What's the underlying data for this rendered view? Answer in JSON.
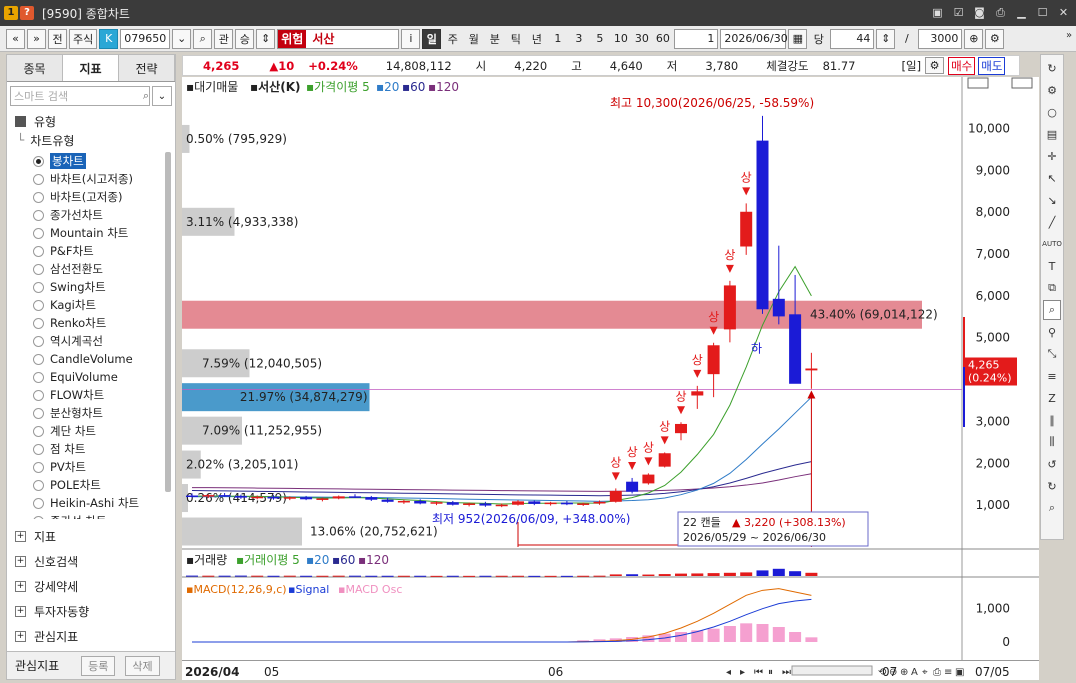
{
  "window": {
    "code": "[9590]",
    "title": "종합차트",
    "badge1": "1",
    "badge2": "?"
  },
  "toolbar": {
    "prev": "«",
    "down": "»",
    "jeon": "전",
    "market": "주식",
    "k_badge": "K",
    "stock_code": "079650",
    "gwan": "관",
    "seung": "승",
    "risk": "위험",
    "stock_name": "서산",
    "info": "i",
    "periods": [
      "일",
      "주",
      "월",
      "분",
      "틱",
      "년"
    ],
    "active_period": "일",
    "intervals": [
      "1",
      "3",
      "5",
      "10",
      "30",
      "60"
    ],
    "interval_value": "1",
    "date": "2026/06/30",
    "dang": "당",
    "count": "44",
    "slash": "/",
    "total": "3000"
  },
  "left": {
    "tabs": [
      "종목",
      "지표",
      "전략"
    ],
    "active_tab": "지표",
    "search_placeholder": "스마트 검색",
    "group_type": "유형",
    "subgroup": "차트유형",
    "chart_types": [
      "봉차트",
      "바차트(시고저종)",
      "바차트(고저종)",
      "종가선차트",
      "Mountain 차트",
      "P&F차트",
      "삼선전환도",
      "Swing차트",
      "Kagi차트",
      "Renko차트",
      "역시계곡선",
      "CandleVolume",
      "EquiVolume",
      "FLOW차트",
      "분산형차트",
      "계단 차트",
      "점 차트",
      "PV차트",
      "POLE차트",
      "Heikin-Ashi 차트",
      "종가선 차트"
    ],
    "selected_type": "봉차트",
    "groups": [
      "지표",
      "신호검색",
      "강세약세",
      "투자자동향",
      "관심지표"
    ],
    "bottom_label": "관심지표",
    "register": "등록",
    "delete": "삭제"
  },
  "infobar": {
    "price": "4,265",
    "change": "▲10",
    "pct": "+0.24%",
    "volume": "14,808,112",
    "open_label": "시",
    "open": "4,220",
    "high_label": "고",
    "high": "4,640",
    "low_label": "저",
    "low": "3,780",
    "strength_label": "체결강도",
    "strength": "81.77",
    "unit": "[일]",
    "buy": "매수",
    "sell": "매도"
  },
  "legend": {
    "tag": "대기매물",
    "name": "서산(K)",
    "ma_label": "가격이평",
    "ma": [
      "5",
      "20",
      "60",
      "120"
    ]
  },
  "annotations": {
    "high": "최고 10,300(2026/06/25, -58.59%)",
    "low": "최저 952(2026/06/09, +348.00%)",
    "box_line1_count": "22 캔들",
    "box_line1_change": "▲ 3,220 (+308.13%)",
    "box_line2": "2026/05/29 ~ 2026/06/30",
    "up_mark": "상",
    "down_mark": "하",
    "price_tag": "4,265",
    "price_tag_pct": "(0.24%)"
  },
  "colors": {
    "up": "#e31b1b",
    "down": "#1b1bd6",
    "ma5": "#3ca02c",
    "ma20": "#2f7cc8",
    "ma60": "#2a2a90",
    "ma120": "#7a2f7a",
    "vp_highlight": "#e48a93",
    "vp_blue": "#4a9acb",
    "vp_grey": "#c8c8c8"
  },
  "volume_panel": {
    "label": "거래량",
    "ma_label": "거래이평",
    "ma": [
      "5",
      "20",
      "60",
      "120"
    ]
  },
  "macd_panel": {
    "label": "MACD(12,26,9,c)",
    "signal": "Signal",
    "osc": "MACD Osc",
    "ticks": [
      "1,000",
      "0"
    ]
  },
  "xaxis": {
    "labels": [
      "2026/04",
      "05",
      "06",
      "07",
      "07/05"
    ]
  },
  "chart_data": {
    "type": "candlestick",
    "y_axis_ticks": [
      1000,
      2000,
      3000,
      4000,
      5000,
      6000,
      7000,
      8000,
      9000,
      10000
    ],
    "ylim": [
      0,
      10800
    ],
    "candles": [
      {
        "o": 1230,
        "h": 1280,
        "l": 1180,
        "c": 1210
      },
      {
        "o": 1210,
        "h": 1260,
        "l": 1170,
        "c": 1240
      },
      {
        "o": 1240,
        "h": 1290,
        "l": 1200,
        "c": 1220
      },
      {
        "o": 1220,
        "h": 1250,
        "l": 1150,
        "c": 1180
      },
      {
        "o": 1180,
        "h": 1230,
        "l": 1140,
        "c": 1200
      },
      {
        "o": 1200,
        "h": 1240,
        "l": 1130,
        "c": 1160
      },
      {
        "o": 1160,
        "h": 1210,
        "l": 1120,
        "c": 1190
      },
      {
        "o": 1190,
        "h": 1220,
        "l": 1120,
        "c": 1140
      },
      {
        "o": 1140,
        "h": 1180,
        "l": 1090,
        "c": 1160
      },
      {
        "o": 1160,
        "h": 1230,
        "l": 1140,
        "c": 1210
      },
      {
        "o": 1210,
        "h": 1260,
        "l": 1170,
        "c": 1190
      },
      {
        "o": 1190,
        "h": 1220,
        "l": 1100,
        "c": 1130
      },
      {
        "o": 1130,
        "h": 1170,
        "l": 1060,
        "c": 1080
      },
      {
        "o": 1080,
        "h": 1130,
        "l": 1030,
        "c": 1100
      },
      {
        "o": 1100,
        "h": 1140,
        "l": 1020,
        "c": 1040
      },
      {
        "o": 1040,
        "h": 1090,
        "l": 1000,
        "c": 1070
      },
      {
        "o": 1070,
        "h": 1100,
        "l": 990,
        "c": 1010
      },
      {
        "o": 1010,
        "h": 1060,
        "l": 970,
        "c": 1040
      },
      {
        "o": 1040,
        "h": 1080,
        "l": 960,
        "c": 990
      },
      {
        "o": 990,
        "h": 1040,
        "l": 952,
        "c": 1010
      },
      {
        "o": 1010,
        "h": 1120,
        "l": 990,
        "c": 1090
      },
      {
        "o": 1090,
        "h": 1110,
        "l": 1000,
        "c": 1030
      },
      {
        "o": 1030,
        "h": 1080,
        "l": 990,
        "c": 1060
      },
      {
        "o": 1060,
        "h": 1100,
        "l": 1000,
        "c": 1020
      },
      {
        "o": 1020,
        "h": 1060,
        "l": 980,
        "c": 1040
      },
      {
        "o": 1040,
        "h": 1110,
        "l": 1010,
        "c": 1080
      },
      {
        "o": 1080,
        "h": 1400,
        "l": 1060,
        "c": 1340
      },
      {
        "o": 1560,
        "h": 1650,
        "l": 1280,
        "c": 1320
      },
      {
        "o": 1520,
        "h": 1760,
        "l": 1490,
        "c": 1730
      },
      {
        "o": 1920,
        "h": 2260,
        "l": 1900,
        "c": 2240
      },
      {
        "o": 2720,
        "h": 2980,
        "l": 2550,
        "c": 2940
      },
      {
        "o": 3620,
        "h": 3850,
        "l": 3300,
        "c": 3720
      },
      {
        "o": 4130,
        "h": 4880,
        "l": 3580,
        "c": 4820
      },
      {
        "o": 5200,
        "h": 6360,
        "l": 4890,
        "c": 6250
      },
      {
        "o": 7180,
        "h": 8210,
        "l": 6980,
        "c": 8010
      },
      {
        "o": 9710,
        "h": 10300,
        "l": 5570,
        "c": 5680
      },
      {
        "o": 5930,
        "h": 7200,
        "l": 5320,
        "c": 5510
      },
      {
        "o": 5560,
        "h": 6500,
        "l": 3960,
        "c": 3900
      },
      {
        "o": 4220,
        "h": 4640,
        "l": 3780,
        "c": 4265
      }
    ],
    "ma5": [
      1215,
      1218,
      1220,
      1214,
      1210,
      1200,
      1190,
      1176,
      1170,
      1172,
      1180,
      1170,
      1150,
      1130,
      1110,
      1085,
      1060,
      1052,
      1042,
      1026,
      1038,
      1044,
      1046,
      1050,
      1050,
      1046,
      1110,
      1180,
      1290,
      1470,
      1790,
      2210,
      2690,
      3390,
      4300,
      5300,
      6100,
      6700,
      6000
    ],
    "ma20": [
      1200,
      1202,
      1204,
      1205,
      1203,
      1201,
      1198,
      1195,
      1192,
      1190,
      1188,
      1184,
      1178,
      1172,
      1166,
      1158,
      1150,
      1142,
      1136,
      1128,
      1122,
      1116,
      1110,
      1104,
      1098,
      1090,
      1100,
      1110,
      1130,
      1170,
      1250,
      1360,
      1520,
      1760,
      2090,
      2460,
      2820,
      3200,
      3580
    ],
    "ma60": [
      1350,
      1345,
      1340,
      1336,
      1330,
      1325,
      1320,
      1314,
      1310,
      1305,
      1300,
      1296,
      1290,
      1285,
      1280,
      1274,
      1268,
      1262,
      1256,
      1250,
      1246,
      1242,
      1238,
      1234,
      1230,
      1226,
      1230,
      1240,
      1255,
      1280,
      1320,
      1375,
      1440,
      1530,
      1640,
      1760,
      1860,
      1960,
      2040
    ],
    "ma120": [
      1420,
      1418,
      1415,
      1412,
      1408,
      1404,
      1400,
      1396,
      1392,
      1388,
      1384,
      1380,
      1376,
      1372,
      1368,
      1364,
      1360,
      1356,
      1352,
      1348,
      1345,
      1342,
      1339,
      1336,
      1333,
      1330,
      1332,
      1336,
      1342,
      1352,
      1366,
      1386,
      1410,
      1440,
      1480,
      1530,
      1600,
      1680,
      1750
    ],
    "volume_profile": [
      {
        "price": 9750,
        "pct": "0.50% (795,929)",
        "frac": 0.02,
        "kind": "grey"
      },
      {
        "price": 7770,
        "pct": "3.11% (4,933,338)",
        "frac": 0.14,
        "kind": "grey"
      },
      {
        "price": 5550,
        "pct": "43.40% (69,014,122)",
        "frac": 1.0,
        "kind": "highlight"
      },
      {
        "price": 4390,
        "pct": "7.59% (12,040,505)",
        "frac": 0.18,
        "kind": "grey"
      },
      {
        "price": 3580,
        "pct": "21.97% (34,874,279)",
        "frac": 0.5,
        "kind": "blue"
      },
      {
        "price": 2780,
        "pct": "7.09% (11,252,955)",
        "frac": 0.16,
        "kind": "grey"
      },
      {
        "price": 1970,
        "pct": "2.02% (3,205,101)",
        "frac": 0.05,
        "kind": "grey"
      },
      {
        "price": 1170,
        "pct": "0.26% (414,579)",
        "frac": 0.01,
        "kind": "grey"
      },
      {
        "price": 370,
        "pct": "13.06% (20,752,621)",
        "frac": 0.32,
        "kind": "grey"
      }
    ],
    "volume": [
      0.05,
      0.04,
      0.04,
      0.05,
      0.04,
      0.03,
      0.04,
      0.03,
      0.03,
      0.04,
      0.04,
      0.03,
      0.03,
      0.03,
      0.03,
      0.02,
      0.03,
      0.02,
      0.03,
      0.03,
      0.03,
      0.02,
      0.02,
      0.02,
      0.03,
      0.04,
      0.2,
      0.22,
      0.18,
      0.24,
      0.3,
      0.32,
      0.36,
      0.4,
      0.45,
      0.7,
      0.9,
      0.6,
      0.4
    ],
    "macd": [
      0,
      0,
      0,
      0,
      0,
      0,
      0,
      0,
      0,
      0,
      0,
      0,
      0,
      0,
      0,
      0,
      0,
      0,
      0,
      0,
      0,
      0,
      0,
      0,
      10,
      20,
      40,
      80,
      150,
      260,
      420,
      620,
      860,
      1130,
      1400,
      1550,
      1600,
      1500,
      1400
    ],
    "signal": [
      0,
      0,
      0,
      0,
      0,
      0,
      0,
      0,
      0,
      0,
      0,
      0,
      0,
      0,
      0,
      0,
      0,
      0,
      0,
      0,
      0,
      0,
      0,
      0,
      5,
      10,
      20,
      40,
      70,
      120,
      200,
      310,
      450,
      620,
      820,
      1000,
      1150,
      1230,
      1280
    ],
    "osc": [
      0,
      0,
      0,
      0,
      0,
      0,
      0,
      0,
      0,
      0,
      0,
      0,
      0,
      0,
      0,
      0,
      0,
      0,
      0,
      0,
      0,
      0,
      0,
      0,
      50,
      80,
      110,
      150,
      200,
      250,
      300,
      350,
      400,
      480,
      560,
      540,
      450,
      300,
      140
    ],
    "macd_ylim": [
      0,
      1800
    ]
  }
}
